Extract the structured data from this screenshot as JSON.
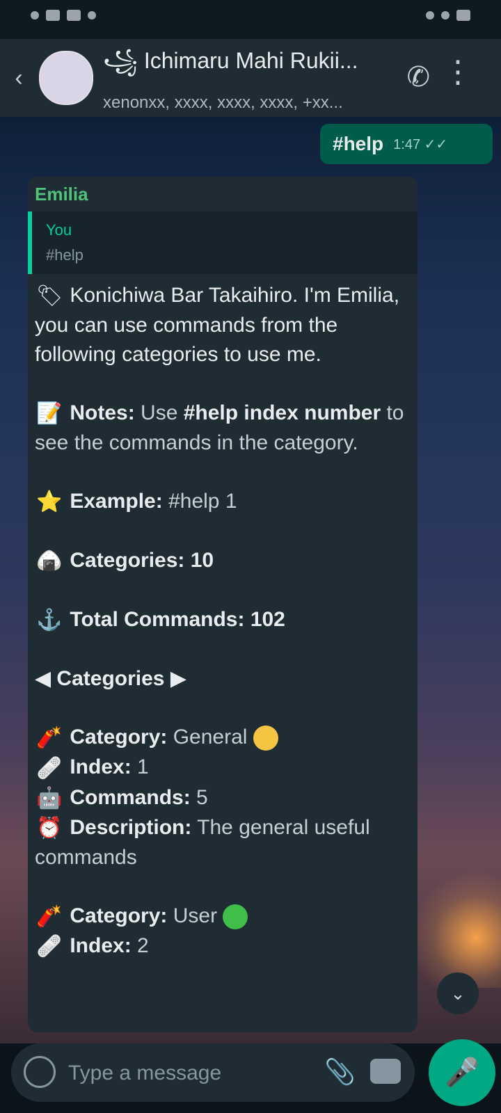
{
  "status_bar": {},
  "header": {
    "back_icon": "arrow-left-icon",
    "title": "꧁ Ichimaru Mahi Rukii...",
    "subtitle": "xenonxx, xxxx, xxxx, xxxx, +xx...",
    "call_icon": "phone-icon",
    "menu_icon": "more-vertical-icon"
  },
  "outgoing": {
    "text": "#help",
    "time": "1:47 ✓✓"
  },
  "message": {
    "sender": "Emilia",
    "quote": {
      "author": "You",
      "text": "#help"
    },
    "intro": "Konichiwa Bar Takaihiro. I'm Emilia, you can use commands from the following categories to use me.",
    "note_label": "Notes:",
    "note_text_a": "Use",
    "note_cmd": "#help index number",
    "note_text_b": "to see the commands in the category.",
    "example_label": "Example:",
    "example_value": "#help 1",
    "categories_label": "Categories:",
    "categories_count": "10",
    "total_label": "Total Commands:",
    "total_count": "102",
    "section_title": "Categories",
    "cat1": {
      "category_label": "Category:",
      "category_value": "General",
      "index_label": "Index:",
      "index_value": "1",
      "commands_label": "Commands:",
      "commands_value": "5",
      "desc_label": "Description:",
      "desc_value": "The general useful commands"
    },
    "cat2": {
      "category_label": "Category:",
      "category_value": "User",
      "index_label": "Index:",
      "index_value": "2"
    }
  },
  "composer": {
    "placeholder": "Type a message"
  },
  "colors": {
    "accent": "#00a884",
    "bubble": "#1f2c34",
    "header": "#1f2c34",
    "outgoing": "#005c4b"
  }
}
